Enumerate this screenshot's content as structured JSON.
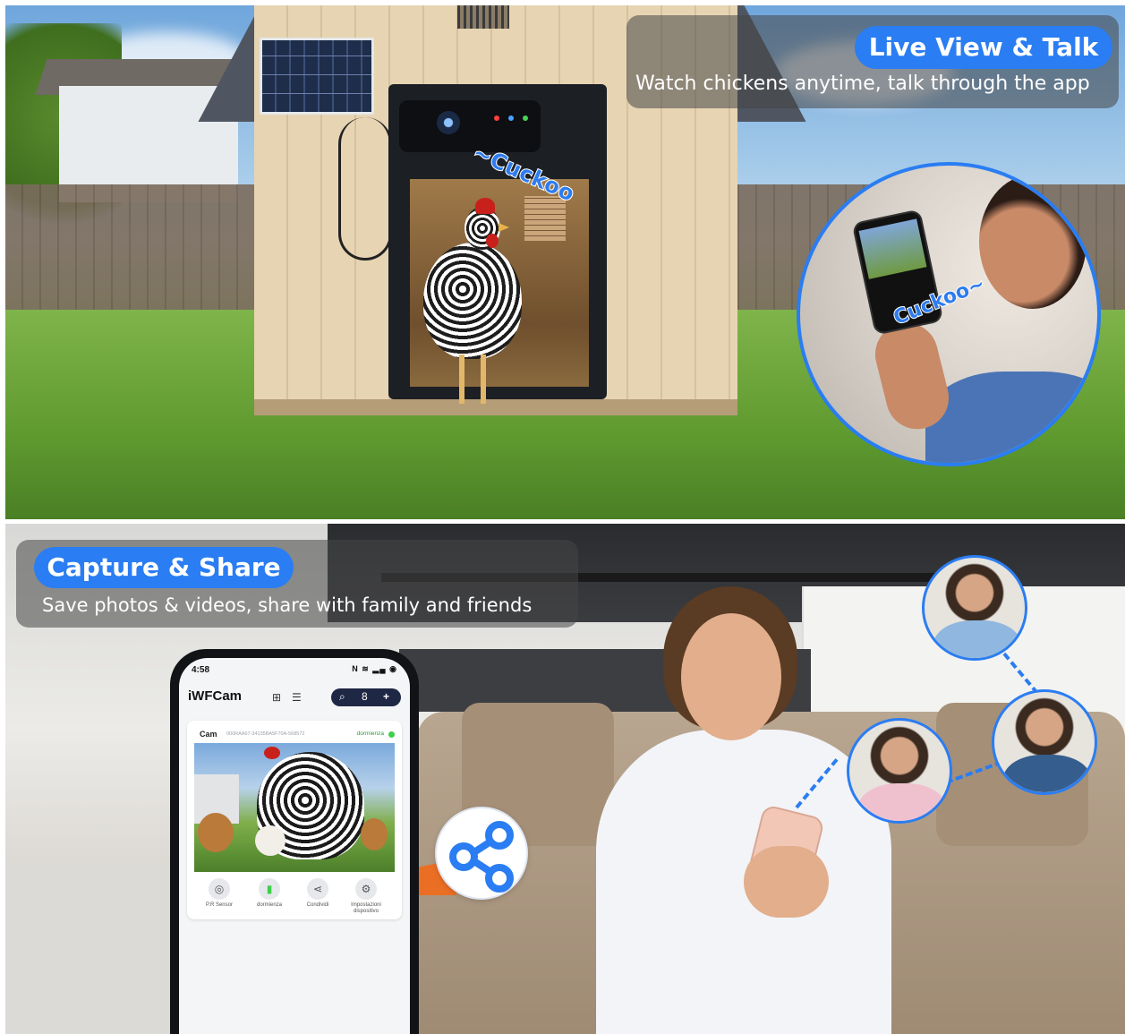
{
  "top_panel": {
    "title": "Live View & Talk",
    "subtitle": "Watch chickens anytime, talk through the app",
    "door_sound": "~Cuckoo",
    "phone_sound": "Cuckoo~"
  },
  "bottom_panel": {
    "title": "Capture & Share",
    "subtitle": "Save photos & videos, share with family and friends"
  },
  "app": {
    "status_time": "4:58",
    "status_icons": "N ≋ ▂▄ ◉",
    "name": "iWFCam",
    "header_icons": [
      "⊞",
      "☰"
    ],
    "pill_icons": [
      "⌕",
      "8",
      "+"
    ],
    "camera": {
      "name": "Cam",
      "device_id": "000RAA67-34135BA5F70A-568572",
      "status": "dormienza",
      "status_color": "#3ecf4b"
    },
    "actions": [
      {
        "label": "P.R Sensor",
        "icon": "motion-sensor-icon",
        "glyph": "◎"
      },
      {
        "label": "dormienza",
        "icon": "battery-icon",
        "glyph": "▮"
      },
      {
        "label": "Condividi",
        "icon": "share-icon",
        "glyph": "⋖"
      },
      {
        "label": "Impostazioni dispositivo",
        "icon": "gear-icon",
        "glyph": "⚙"
      }
    ]
  },
  "colors": {
    "accent": "#2a7df2",
    "share_arrow": "#ea6f24"
  }
}
